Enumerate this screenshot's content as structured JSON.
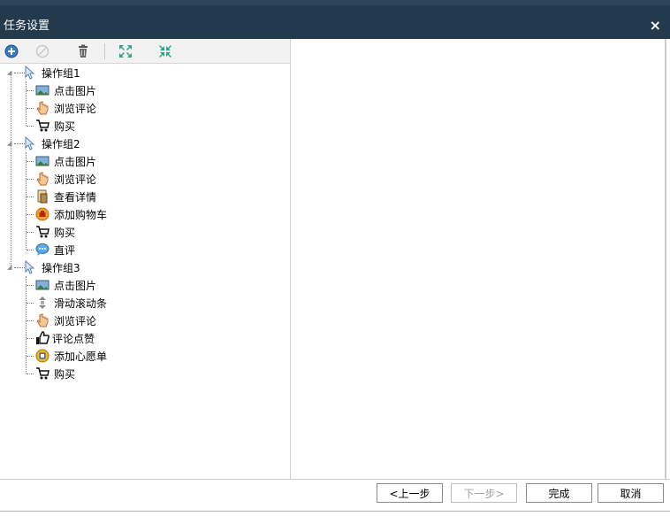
{
  "window": {
    "title": "任务设置",
    "close_glyph": "×"
  },
  "toolbar": {
    "icons": [
      "add-icon",
      "disable-icon",
      "delete-icon",
      "expand-all-icon",
      "collapse-all-icon"
    ]
  },
  "tree": {
    "groups": [
      {
        "label": "操作组1",
        "items": [
          {
            "label": "点击图片",
            "icon": "picture-icon"
          },
          {
            "label": "浏览评论",
            "icon": "hand-icon"
          },
          {
            "label": "购买",
            "icon": "cart-icon"
          }
        ]
      },
      {
        "label": "操作组2",
        "items": [
          {
            "label": "点击图片",
            "icon": "picture-icon"
          },
          {
            "label": "浏览评论",
            "icon": "hand-icon"
          },
          {
            "label": "查看详情",
            "icon": "detail-icon"
          },
          {
            "label": "添加购物车",
            "icon": "add-cart-icon"
          },
          {
            "label": "购买",
            "icon": "cart-icon"
          },
          {
            "label": "直评",
            "icon": "comment-bubble-icon"
          }
        ]
      },
      {
        "label": "操作组3",
        "items": [
          {
            "label": "点击图片",
            "icon": "picture-icon"
          },
          {
            "label": "滑动滚动条",
            "icon": "scroll-icon"
          },
          {
            "label": "浏览评论",
            "icon": "hand-icon"
          },
          {
            "label": "评论点赞",
            "icon": "thumbs-up-icon"
          },
          {
            "label": "添加心愿单",
            "icon": "wishlist-icon"
          },
          {
            "label": "购买",
            "icon": "cart-icon"
          }
        ]
      }
    ]
  },
  "footer": {
    "prev_label": "<上一步",
    "next_label": "下一步>",
    "finish_label": "完成",
    "cancel_label": "取消"
  }
}
